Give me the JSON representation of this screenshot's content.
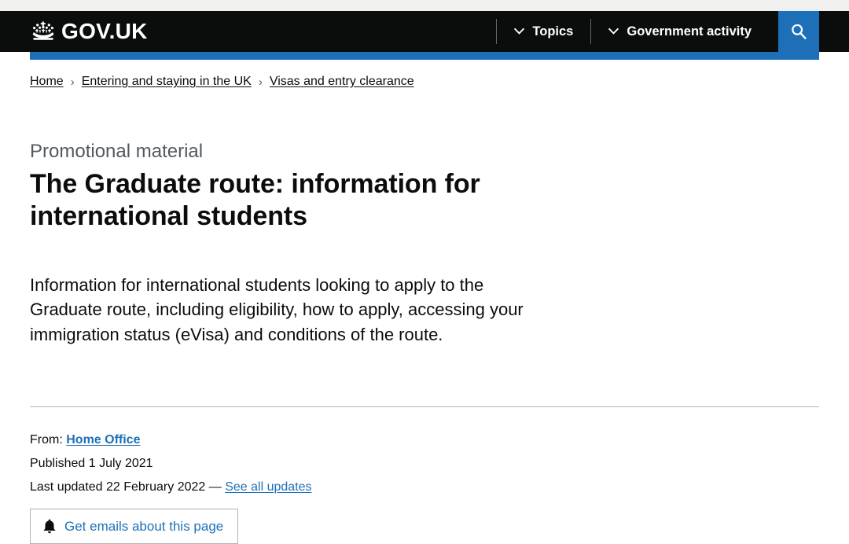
{
  "header": {
    "logo_text": "GOV.UK",
    "logo_icon": "crown-icon",
    "nav_items": [
      {
        "label": "Topics",
        "icon": "chevron-down-icon"
      },
      {
        "label": "Government activity",
        "icon": "chevron-down-icon"
      }
    ],
    "search": {
      "icon": "search-icon",
      "label": "Search"
    },
    "colors": {
      "background": "#0b0c0c",
      "accent_blue": "#1d70b8"
    }
  },
  "breadcrumbs": [
    {
      "label": "Home"
    },
    {
      "label": "Entering and staying in the UK"
    },
    {
      "label": "Visas and entry clearance"
    }
  ],
  "breadcrumb_separator": "›",
  "main": {
    "document_type": "Promotional material",
    "title": "The Graduate route: information for international students",
    "description": "Information for international students looking to apply to the Graduate route, including eligibility, how to apply, accessing your immigration status (eVisa) and conditions of the route."
  },
  "metadata": {
    "from_label": "From:",
    "organisation": "Home Office",
    "published_label": "Published",
    "published_date": "1 July 2021",
    "last_updated_label": "Last updated",
    "last_updated_date": "22 February 2022",
    "dash": "—",
    "see_all_updates": "See all updates"
  },
  "email_signup": {
    "label": "Get emails about this page",
    "icon": "bell-icon"
  },
  "colors": {
    "link_blue": "#1d70b8",
    "text_black": "#0b0c0c",
    "muted_grey": "#505a5f",
    "border_grey": "#b1b4b6",
    "strip_grey": "#f0f0ef"
  }
}
